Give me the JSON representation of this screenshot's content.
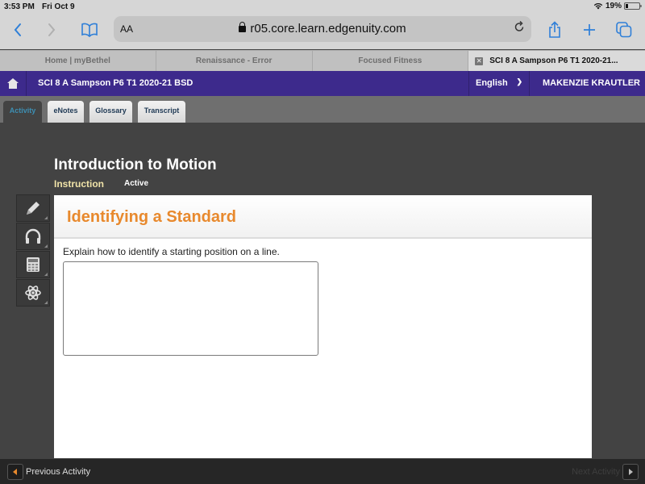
{
  "status_bar": {
    "time": "3:53 PM",
    "date": "Fri Oct 9",
    "battery": "19%"
  },
  "browser": {
    "text_size_label": "AA",
    "url": "r05.core.learn.edgenuity.com",
    "icons": [
      "back-icon",
      "forward-icon",
      "bookmarks-icon",
      "lock-icon",
      "reload-icon",
      "share-icon",
      "new-tab-icon",
      "tabs-icon"
    ],
    "tabs": [
      {
        "label": "Home | myBethel",
        "active": false
      },
      {
        "label": "Renaissance - Error",
        "active": false
      },
      {
        "label": "Focused Fitness",
        "active": false
      },
      {
        "label": "SCI 8 A Sampson P6 T1 2020-21...",
        "active": true
      }
    ]
  },
  "header": {
    "course": "SCI 8 A Sampson P6 T1 2020-21 BSD",
    "language": "English",
    "user": "MAKENZIE KRAUTLER",
    "brand_color": "#3d2a8c"
  },
  "subtabs": [
    {
      "label": "Activity",
      "active": true
    },
    {
      "label": "eNotes",
      "active": false
    },
    {
      "label": "Glossary",
      "active": false
    },
    {
      "label": "Transcript",
      "active": false
    }
  ],
  "lesson": {
    "title": "Introduction to Motion",
    "section": "Instruction",
    "status": "Active"
  },
  "tools": [
    "pencil-icon",
    "headphones-icon",
    "calculator-icon",
    "atom-icon"
  ],
  "activity": {
    "heading": "Identifying a Standard",
    "heading_color": "#e8892d",
    "question": "Explain how to identify a starting position on a line.",
    "answer_value": ""
  },
  "footer": {
    "previous_label": "Previous Activity",
    "next_label": "Next Activity"
  }
}
